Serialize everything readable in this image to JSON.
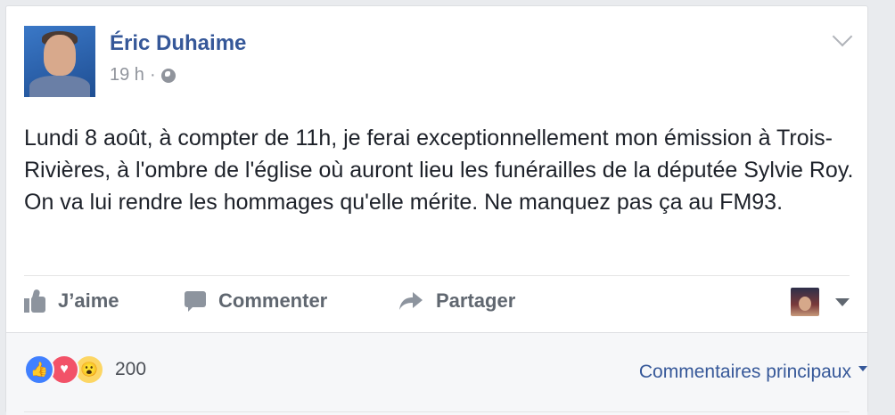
{
  "post": {
    "author": "Éric Duhaime",
    "time": "19 h",
    "separator": "·",
    "text": "Lundi 8 août, à compter de 11h, je ferai exceptionnellement mon émission à Trois-Rivières, à l'ombre de l'église où auront lieu les funérailles de la députée Sylvie Roy. On va lui rendre les hommages qu'elle mérite. Ne manquez pas ça au FM93."
  },
  "actions": {
    "like": "J’aime",
    "comment": "Commenter",
    "share": "Partager"
  },
  "footer": {
    "reaction_count": "200",
    "sort_label": "Commentaires principaux"
  },
  "colors": {
    "link_blue": "#365899",
    "like_blue": "#4080ff",
    "love_red": "#f25268",
    "wow_yellow": "#fcd664"
  },
  "icons": {
    "privacy": "globe-icon",
    "menu": "chevron-down-icon",
    "like": "thumbs-up-icon",
    "comment": "comment-bubble-icon",
    "share": "share-arrow-icon"
  }
}
